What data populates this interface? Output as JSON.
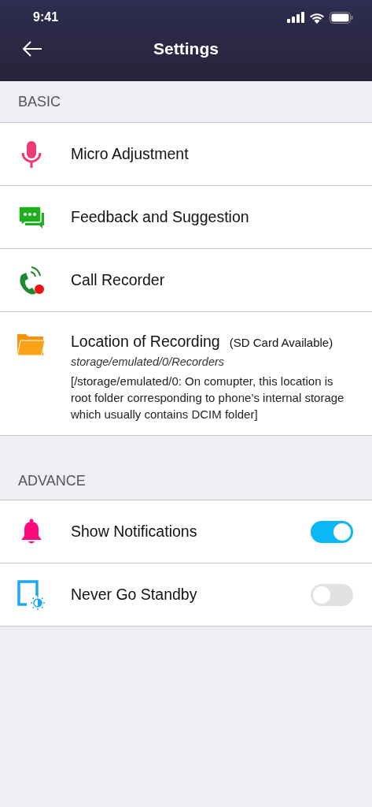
{
  "status_bar": {
    "time": "9:41"
  },
  "header": {
    "title": "Settings"
  },
  "sections": [
    {
      "title": "BASIC",
      "items": [
        {
          "kind": "link",
          "label": "Micro Adjustment"
        },
        {
          "kind": "link",
          "label": "Feedback and Suggestion"
        },
        {
          "kind": "link",
          "label": "Call Recorder"
        },
        {
          "kind": "location",
          "label": "Location of Recording",
          "badge": "(SD Card Available)",
          "path": "storage/emulated/0/Recorders",
          "note": "[/storage/emulated/0: On comupter, this location is root folder corresponding to phone’s internal storage which usually contains DCIM folder]"
        }
      ]
    },
    {
      "title": "ADVANCE",
      "items": [
        {
          "kind": "toggle",
          "label": "Show Notifications",
          "on": true
        },
        {
          "kind": "toggle",
          "label": "Never Go Standby",
          "on": false
        }
      ]
    }
  ]
}
